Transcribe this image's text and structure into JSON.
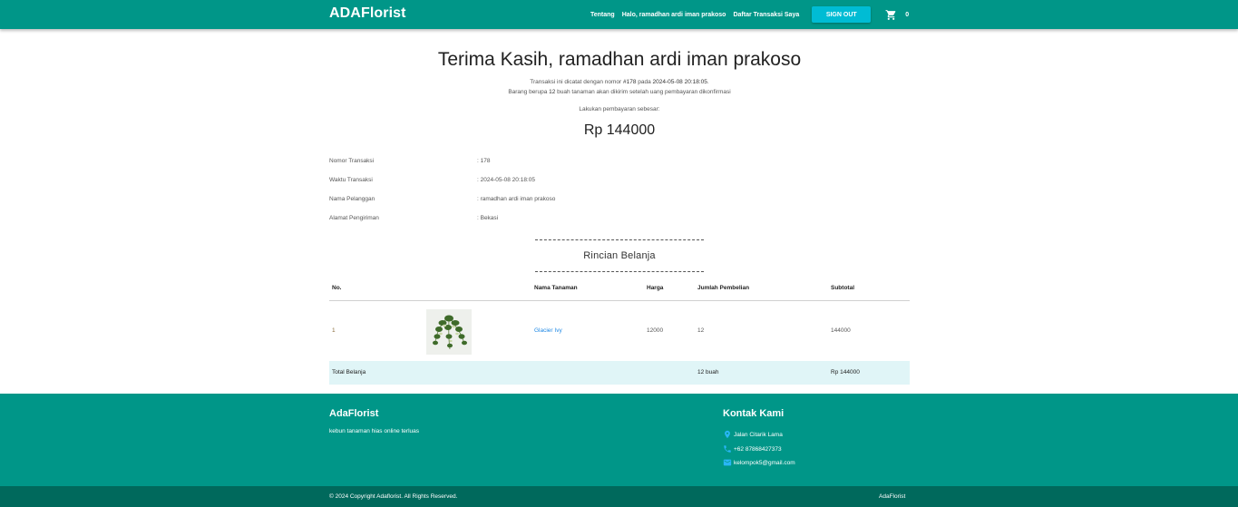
{
  "navbar": {
    "brand": "ADAFlorist",
    "links": [
      "Tentang",
      "Halo, ramadhan ardi iman prakoso",
      "Daftar Transaksi Saya"
    ],
    "signout_label": "SIGN OUT",
    "cart_count": "0"
  },
  "main": {
    "thanks": "Terima Kasih, ramadhan ardi iman prakoso",
    "info1_prefix": "Transaksi ini dicatat dengan nomor ",
    "info1_number": "#178",
    "info1_mid": " pada ",
    "info1_date": "2024-05-08 20:18:05",
    "info1_suffix": ".",
    "info2_prefix": "Barang berupa ",
    "info2_count": "12",
    "info2_suffix": " buah tanaman akan dikirim setelah uang pembayaran dikonfirmasi",
    "pay_label": "Lakukan pembayaran sebesar:",
    "pay_amount": "Rp 144000",
    "details": [
      {
        "label": "Nomor Transaksi",
        "value": ": 178"
      },
      {
        "label": "Waktu Transaksi",
        "value": ": 2024-05-08 20:18:05"
      },
      {
        "label": "Nama Pelanggan",
        "value": ": ramadhan ardi iman prakoso"
      },
      {
        "label": "Alamat Pengiriman",
        "value": ": Bekasi"
      }
    ],
    "rincian_title": "Rincian Belanja"
  },
  "table": {
    "headers": [
      "No.",
      "Nama Tanaman",
      "Harga",
      "Jumlah Pembelian",
      "Subtotal"
    ],
    "rows": [
      {
        "no": "1",
        "name": "Glacier Ivy",
        "price": "12000",
        "qty": "12",
        "subtotal": "144000"
      }
    ],
    "total": {
      "label": "Total Belanja",
      "qty": "12 buah",
      "amount": "Rp 144000"
    }
  },
  "footer": {
    "brand": "AdaFlorist",
    "tagline": "kebun tanaman hias online terluas",
    "contact_title": "Kontak Kami",
    "contacts": [
      {
        "icon": "location-icon",
        "text": "Jalan Citarik Lama"
      },
      {
        "icon": "phone-icon",
        "text": "+62 87868427373"
      },
      {
        "icon": "email-icon",
        "text": "kelompok5@gmail.com"
      }
    ],
    "copyright": "© 2024 Copyright Adaflorist. All Rights Reserved.",
    "bottom_brand": "AdaFlorist"
  },
  "colors": {
    "primary": "#009688",
    "dark": "#00695c",
    "accent": "#00bcd4",
    "total_bg": "#e0f5f7",
    "link": "#1e88e5"
  }
}
